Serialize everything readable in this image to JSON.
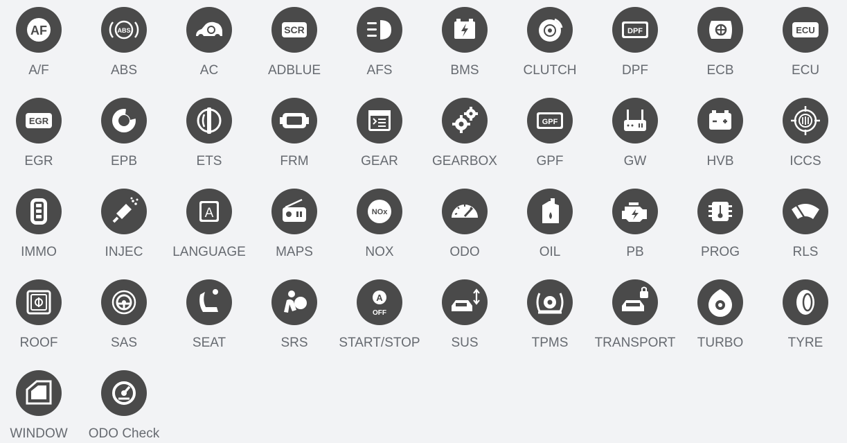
{
  "functions": [
    {
      "label": "A/F",
      "icon": "af-icon"
    },
    {
      "label": "ABS",
      "icon": "abs-icon"
    },
    {
      "label": "AC",
      "icon": "ac-icon"
    },
    {
      "label": "ADBLUE",
      "icon": "scr-icon",
      "icon_text": "SCR"
    },
    {
      "label": "AFS",
      "icon": "headlight-icon"
    },
    {
      "label": "BMS",
      "icon": "battery-charge-icon"
    },
    {
      "label": "CLUTCH",
      "icon": "clutch-icon"
    },
    {
      "label": "DPF",
      "icon": "dpf-icon",
      "icon_text": "DPF"
    },
    {
      "label": "ECB",
      "icon": "ecb-icon"
    },
    {
      "label": "ECU",
      "icon": "ecu-icon",
      "icon_text": "ECU"
    },
    {
      "label": "EGR",
      "icon": "egr-icon",
      "icon_text": "EGR"
    },
    {
      "label": "EPB",
      "icon": "brake-disc-icon"
    },
    {
      "label": "ETS",
      "icon": "throttle-icon"
    },
    {
      "label": "FRM",
      "icon": "module-icon"
    },
    {
      "label": "GEAR",
      "icon": "gear-screen-icon"
    },
    {
      "label": "GEARBOX",
      "icon": "cogs-icon"
    },
    {
      "label": "GPF",
      "icon": "gpf-icon",
      "icon_text": "GPF"
    },
    {
      "label": "GW",
      "icon": "router-icon"
    },
    {
      "label": "HVB",
      "icon": "battery-icon"
    },
    {
      "label": "ICCS",
      "icon": "target-icon"
    },
    {
      "label": "IMMO",
      "icon": "key-fob-icon"
    },
    {
      "label": "INJEC",
      "icon": "injector-icon"
    },
    {
      "label": "LANGUAGE",
      "icon": "language-icon",
      "icon_text": "A"
    },
    {
      "label": "MAPS",
      "icon": "radio-icon"
    },
    {
      "label": "NOX",
      "icon": "nox-icon",
      "icon_text": "NOx"
    },
    {
      "label": "ODO",
      "icon": "speedometer-icon"
    },
    {
      "label": "OIL",
      "icon": "oil-can-icon"
    },
    {
      "label": "PB",
      "icon": "engine-icon"
    },
    {
      "label": "PROG",
      "icon": "chip-icon"
    },
    {
      "label": "RLS",
      "icon": "wiper-icon"
    },
    {
      "label": "ROOF",
      "icon": "sunroof-icon"
    },
    {
      "label": "SAS",
      "icon": "steering-icon"
    },
    {
      "label": "SEAT",
      "icon": "seat-icon"
    },
    {
      "label": "SRS",
      "icon": "airbag-icon"
    },
    {
      "label": "START/STOP",
      "icon": "start-stop-icon",
      "icon_text": "A",
      "icon_text2": "OFF"
    },
    {
      "label": "SUS",
      "icon": "suspension-icon"
    },
    {
      "label": "TPMS",
      "icon": "tpms-icon"
    },
    {
      "label": "TRANSPORT",
      "icon": "car-lock-icon"
    },
    {
      "label": "TURBO",
      "icon": "turbo-icon"
    },
    {
      "label": "TYRE",
      "icon": "tyre-icon"
    },
    {
      "label": "WINDOW",
      "icon": "window-icon"
    },
    {
      "label": "ODO Check",
      "icon": "odo-check-icon"
    }
  ],
  "colors": {
    "background": "#f2f3f5",
    "icon_disc": "#4a4a4a",
    "icon_glyph": "#ffffff",
    "label": "#666a70"
  }
}
